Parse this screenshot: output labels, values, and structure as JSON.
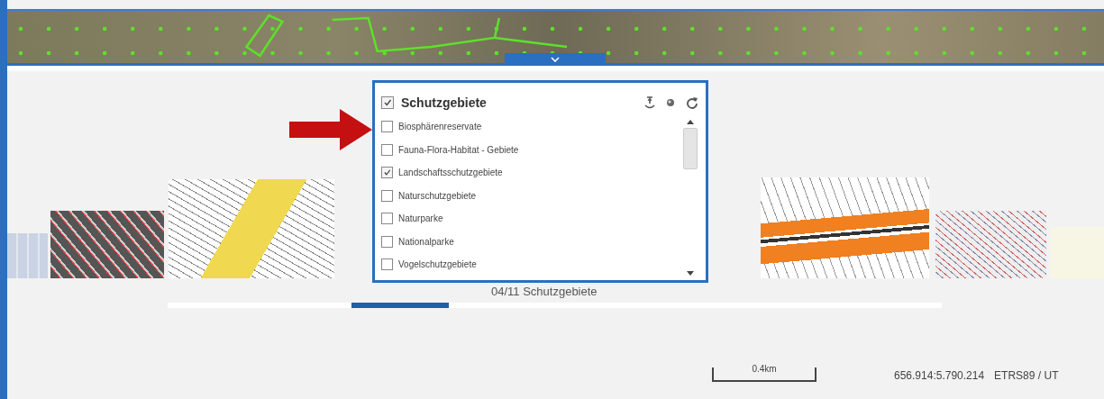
{
  "layer_panel": {
    "title": "Schutzgebiete",
    "checked": true,
    "items": [
      {
        "label": "Biosphärenreservate",
        "checked": false
      },
      {
        "label": "Fauna-Flora-Habitat - Gebiete",
        "checked": false
      },
      {
        "label": "Landschaftsschutzgebiete",
        "checked": true
      },
      {
        "label": "Naturschutzgebiete",
        "checked": false
      },
      {
        "label": "Naturparke",
        "checked": false
      },
      {
        "label": "Nationalparke",
        "checked": false
      },
      {
        "label": "Vogelschutzgebiete",
        "checked": false
      }
    ]
  },
  "carousel": {
    "caption": "04/11 Schutzgebiete"
  },
  "scale": {
    "label": "0.4km"
  },
  "coordinates": "656.914:5.790.214",
  "crs": "ETRS89 / UT"
}
